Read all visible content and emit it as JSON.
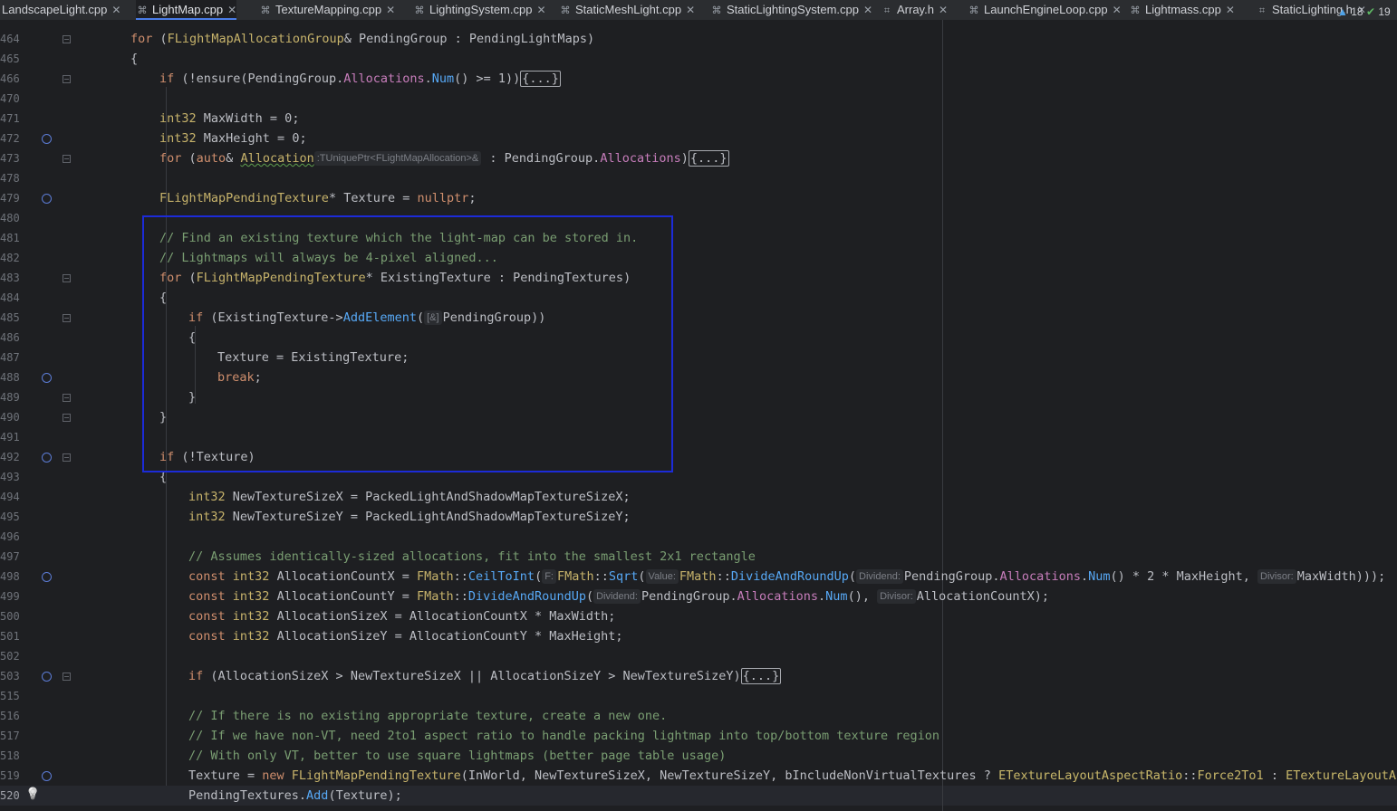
{
  "tabs": [
    {
      "label": "LandscapeLight.cpp",
      "active": false,
      "icon": "cpp-file-icon"
    },
    {
      "label": "LightMap.cpp",
      "active": true,
      "icon": "cpp-file-icon"
    },
    {
      "label": "TextureMapping.cpp",
      "active": false,
      "icon": "cpp-file-icon"
    },
    {
      "label": "LightingSystem.cpp",
      "active": false,
      "icon": "cpp-file-icon"
    },
    {
      "label": "StaticMeshLight.cpp",
      "active": false,
      "icon": "cpp-file-icon"
    },
    {
      "label": "StaticLightingSystem.cpp",
      "active": false,
      "icon": "cpp-file-icon"
    },
    {
      "label": "Array.h",
      "active": false,
      "icon": "header-file-icon"
    },
    {
      "label": "LaunchEngineLoop.cpp",
      "active": false,
      "icon": "cpp-file-icon"
    },
    {
      "label": "Lightmass.cpp",
      "active": false,
      "icon": "cpp-file-icon"
    },
    {
      "label": "StaticLighting.h",
      "active": false,
      "icon": "header-file-icon"
    }
  ],
  "inspections": {
    "warnings": "18",
    "ok": "19"
  },
  "colors": {
    "keyword": "#cf8e6d",
    "type": "#c7b36b",
    "comment": "#7a9e72",
    "function": "#57a8f5",
    "member": "#c77dbb",
    "highlight_box": "#1c2bd8"
  },
  "lines": [
    {
      "n": "464",
      "fold": true,
      "bp": false,
      "ind": 1,
      "toks": [
        [
          "k",
          "for "
        ],
        [
          "v",
          "("
        ],
        [
          "t",
          "FLightMapAllocationGroup"
        ],
        [
          "v",
          "& PendingGroup : PendingLightMaps)"
        ]
      ]
    },
    {
      "n": "465",
      "ind": 1,
      "toks": [
        [
          "v",
          "{"
        ]
      ]
    },
    {
      "n": "466",
      "fold": true,
      "ind": 2,
      "toks": [
        [
          "k",
          "if "
        ],
        [
          "v",
          "(!ensure(PendingGroup."
        ],
        [
          "m",
          "Allocations"
        ],
        [
          "v",
          "."
        ],
        [
          "f",
          "Num"
        ],
        [
          "v",
          "() >= 1))"
        ],
        [
          "fr",
          "{...}"
        ]
      ]
    },
    {
      "n": "470",
      "ind": 2,
      "toks": []
    },
    {
      "n": "471",
      "ind": 2,
      "toks": [
        [
          "t",
          "int32 "
        ],
        [
          "v",
          "MaxWidth = 0;"
        ]
      ]
    },
    {
      "n": "472",
      "bp": true,
      "ind": 2,
      "toks": [
        [
          "t",
          "int32 "
        ],
        [
          "v",
          "MaxHeight = 0;"
        ]
      ]
    },
    {
      "n": "473",
      "fold": true,
      "ind": 2,
      "toks": [
        [
          "k",
          "for "
        ],
        [
          "v",
          "("
        ],
        [
          "k",
          "auto"
        ],
        [
          "v",
          "& "
        ],
        [
          "sq",
          "Allocation"
        ],
        [
          "hint",
          ":TUniquePtr<FLightMapAllocation>&"
        ],
        [
          "v",
          " : PendingGroup."
        ],
        [
          "m",
          "Allocations"
        ],
        [
          "v",
          ")"
        ],
        [
          "fr",
          "{...}"
        ]
      ]
    },
    {
      "n": "478",
      "ind": 2,
      "toks": []
    },
    {
      "n": "479",
      "bp": true,
      "ind": 2,
      "toks": [
        [
          "t",
          "FLightMapPendingTexture"
        ],
        [
          "v",
          "* Texture = "
        ],
        [
          "k",
          "nullptr"
        ],
        [
          "v",
          ";"
        ]
      ]
    },
    {
      "n": "480",
      "ind": 2,
      "toks": []
    },
    {
      "n": "481",
      "ind": 2,
      "toks": [
        [
          "c",
          "// Find an existing texture which the light-map can be stored in."
        ]
      ]
    },
    {
      "n": "482",
      "ind": 2,
      "toks": [
        [
          "c",
          "// Lightmaps will always be 4-pixel aligned..."
        ]
      ]
    },
    {
      "n": "483",
      "fold": true,
      "ind": 2,
      "toks": [
        [
          "k",
          "for "
        ],
        [
          "v",
          "("
        ],
        [
          "t",
          "FLightMapPendingTexture"
        ],
        [
          "v",
          "* ExistingTexture : PendingTextures)"
        ]
      ]
    },
    {
      "n": "484",
      "ind": 2,
      "toks": [
        [
          "v",
          "{"
        ]
      ]
    },
    {
      "n": "485",
      "fold": true,
      "ind": 3,
      "toks": [
        [
          "k",
          "if "
        ],
        [
          "v",
          "(ExistingTexture->"
        ],
        [
          "f",
          "AddElement"
        ],
        [
          "v",
          "("
        ],
        [
          "hint",
          "[&]"
        ],
        [
          "v",
          "PendingGroup))"
        ]
      ]
    },
    {
      "n": "486",
      "ind": 3,
      "toks": [
        [
          "v",
          "{"
        ]
      ]
    },
    {
      "n": "487",
      "ind": 4,
      "toks": [
        [
          "v",
          "Texture = ExistingTexture;"
        ]
      ]
    },
    {
      "n": "488",
      "bp": true,
      "ind": 4,
      "toks": [
        [
          "k",
          "break"
        ],
        [
          "v",
          ";"
        ]
      ]
    },
    {
      "n": "489",
      "fold": true,
      "ind": 3,
      "toks": [
        [
          "v",
          "}"
        ]
      ]
    },
    {
      "n": "490",
      "fold": true,
      "ind": 2,
      "toks": [
        [
          "v",
          "}"
        ]
      ]
    },
    {
      "n": "491",
      "ind": 2,
      "toks": []
    },
    {
      "n": "492",
      "bp": true,
      "fold": true,
      "ind": 2,
      "toks": [
        [
          "k",
          "if "
        ],
        [
          "v",
          "(!Texture)"
        ]
      ]
    },
    {
      "n": "493",
      "ind": 2,
      "toks": [
        [
          "v",
          "{"
        ]
      ]
    },
    {
      "n": "494",
      "ind": 3,
      "toks": [
        [
          "t",
          "int32 "
        ],
        [
          "v",
          "NewTextureSizeX = PackedLightAndShadowMapTextureSizeX;"
        ]
      ]
    },
    {
      "n": "495",
      "ind": 3,
      "toks": [
        [
          "t",
          "int32 "
        ],
        [
          "v",
          "NewTextureSizeY = PackedLightAndShadowMapTextureSizeY;"
        ]
      ]
    },
    {
      "n": "496",
      "ind": 3,
      "toks": []
    },
    {
      "n": "497",
      "ind": 3,
      "toks": [
        [
          "c",
          "// Assumes identically-sized allocations, fit into the smallest 2x1 rectangle"
        ]
      ]
    },
    {
      "n": "498",
      "bp": true,
      "ind": 3,
      "toks": [
        [
          "k",
          "const "
        ],
        [
          "t",
          "int32 "
        ],
        [
          "v",
          "AllocationCountX = "
        ],
        [
          "t",
          "FMath"
        ],
        [
          "v",
          "::"
        ],
        [
          "f",
          "CeilToInt"
        ],
        [
          "v",
          "("
        ],
        [
          "hint",
          "F:"
        ],
        [
          "t",
          "FMath"
        ],
        [
          "v",
          "::"
        ],
        [
          "f",
          "Sqrt"
        ],
        [
          "v",
          "("
        ],
        [
          "hint",
          "Value:"
        ],
        [
          "t",
          "FMath"
        ],
        [
          "v",
          "::"
        ],
        [
          "f",
          "DivideAndRoundUp"
        ],
        [
          "v",
          "("
        ],
        [
          "hint",
          "Dividend:"
        ],
        [
          "v",
          "PendingGroup."
        ],
        [
          "m",
          "Allocations"
        ],
        [
          "v",
          "."
        ],
        [
          "f",
          "Num"
        ],
        [
          "v",
          "() * 2 * MaxHeight, "
        ],
        [
          "hint",
          "Divisor:"
        ],
        [
          "v",
          "MaxWidth)));"
        ]
      ]
    },
    {
      "n": "499",
      "ind": 3,
      "toks": [
        [
          "k",
          "const "
        ],
        [
          "t",
          "int32 "
        ],
        [
          "v",
          "AllocationCountY = "
        ],
        [
          "t",
          "FMath"
        ],
        [
          "v",
          "::"
        ],
        [
          "f",
          "DivideAndRoundUp"
        ],
        [
          "v",
          "("
        ],
        [
          "hint",
          "Dividend:"
        ],
        [
          "v",
          "PendingGroup."
        ],
        [
          "m",
          "Allocations"
        ],
        [
          "v",
          "."
        ],
        [
          "f",
          "Num"
        ],
        [
          "v",
          "(), "
        ],
        [
          "hint",
          "Divisor:"
        ],
        [
          "v",
          "AllocationCountX);"
        ]
      ]
    },
    {
      "n": "500",
      "ind": 3,
      "toks": [
        [
          "k",
          "const "
        ],
        [
          "t",
          "int32 "
        ],
        [
          "v",
          "AllocationSizeX = AllocationCountX * MaxWidth;"
        ]
      ]
    },
    {
      "n": "501",
      "ind": 3,
      "toks": [
        [
          "k",
          "const "
        ],
        [
          "t",
          "int32 "
        ],
        [
          "v",
          "AllocationSizeY = AllocationCountY * MaxHeight;"
        ]
      ]
    },
    {
      "n": "502",
      "ind": 3,
      "toks": []
    },
    {
      "n": "503",
      "bp": true,
      "fold": true,
      "ind": 3,
      "toks": [
        [
          "k",
          "if "
        ],
        [
          "v",
          "(AllocationSizeX > NewTextureSizeX || AllocationSizeY > NewTextureSizeY)"
        ],
        [
          "fr",
          "{...}"
        ]
      ]
    },
    {
      "n": "515",
      "ind": 3,
      "toks": []
    },
    {
      "n": "516",
      "ind": 3,
      "toks": [
        [
          "c",
          "// If there is no existing appropriate texture, create a new one."
        ]
      ]
    },
    {
      "n": "517",
      "ind": 3,
      "toks": [
        [
          "c",
          "// If we have non-VT, need 2to1 aspect ratio to handle packing lightmap into top/bottom texture region"
        ]
      ]
    },
    {
      "n": "518",
      "ind": 3,
      "toks": [
        [
          "c",
          "// With only VT, better to use square lightmaps (better page table usage)"
        ]
      ]
    },
    {
      "n": "519",
      "bp": true,
      "ind": 3,
      "toks": [
        [
          "v",
          "Texture = "
        ],
        [
          "k",
          "new "
        ],
        [
          "t",
          "FLightMapPendingTexture"
        ],
        [
          "v",
          "(InWorld, NewTextureSizeX, NewTextureSizeY, bIncludeNonVirtualTextures ? "
        ],
        [
          "e",
          "ETextureLayoutAspectRatio"
        ],
        [
          "v",
          "::"
        ],
        [
          "e",
          "Force2To1"
        ],
        [
          "v",
          " : "
        ],
        [
          "e",
          "ETextureLayoutAspe"
        ]
      ]
    },
    {
      "n": "520",
      "bulb": true,
      "current": true,
      "ind": 3,
      "toks": [
        [
          "v",
          "PendingTextures."
        ],
        [
          "f",
          "Add"
        ],
        [
          "v",
          "(Texture);"
        ]
      ]
    }
  ]
}
